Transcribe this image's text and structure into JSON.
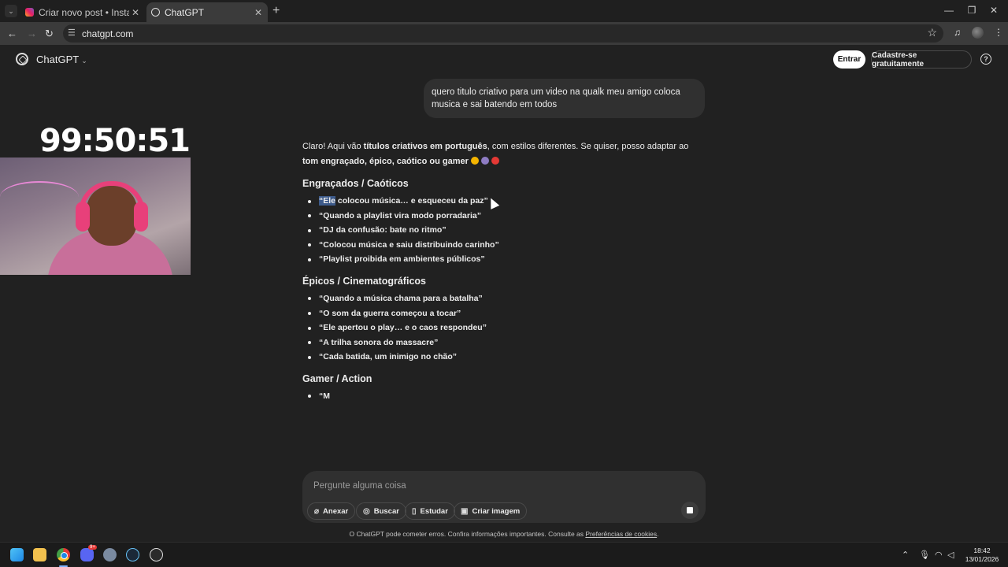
{
  "browser": {
    "tabs": [
      {
        "title": "Criar novo post • Instagram"
      },
      {
        "title": "ChatGPT"
      }
    ],
    "url": "chatgpt.com"
  },
  "header": {
    "brand": "ChatGPT",
    "login_label": "Entrar",
    "signup_label": "Cadastre-se gratuitamente"
  },
  "overlay": {
    "timer": "99:50:51"
  },
  "conversation": {
    "user_message": "quero titulo criativo para um video na qualk meu amigo coloca musica e sai batendo em todos",
    "reply": {
      "intro_1": "Claro! Aqui vão ",
      "intro_bold_1": "títulos criativos em português",
      "intro_2": ", com estilos diferentes. Se quiser, posso adaptar ao ",
      "intro_bold_2": "tom engraçado, épico, caótico ou gamer",
      "sections": [
        {
          "title": "Engraçados / Caóticos",
          "items": [
            "“Ele colocou música… e esqueceu da paz”",
            "“Quando a playlist vira modo porradaria”",
            "“DJ da confusão: bate no ritmo”",
            "“Colocou música e saiu distribuindo carinho”",
            "“Playlist proibida em ambientes públicos”"
          ]
        },
        {
          "title": "Épicos / Cinematográficos",
          "items": [
            "“Quando a música chama para a batalha”",
            "“O som da guerra começou a tocar”",
            "“Ele apertou o play… e o caos respondeu”",
            "“A trilha sonora do massacre”",
            "“Cada batida, um inimigo no chão”"
          ]
        },
        {
          "title": "Gamer / Action",
          "items": [
            "“M"
          ]
        }
      ]
    }
  },
  "composer": {
    "placeholder": "Pergunte alguma coisa",
    "buttons": {
      "attach": "Anexar",
      "search": "Buscar",
      "study": "Estudar",
      "image": "Criar imagem"
    }
  },
  "footer": {
    "disclaimer": "O ChatGPT pode cometer erros. Confira informações importantes. Consulte as ",
    "link": "Preferências de cookies",
    "end": "."
  },
  "taskbar": {
    "badge": "9+",
    "time": "18:42",
    "date": "13/01/2026"
  }
}
